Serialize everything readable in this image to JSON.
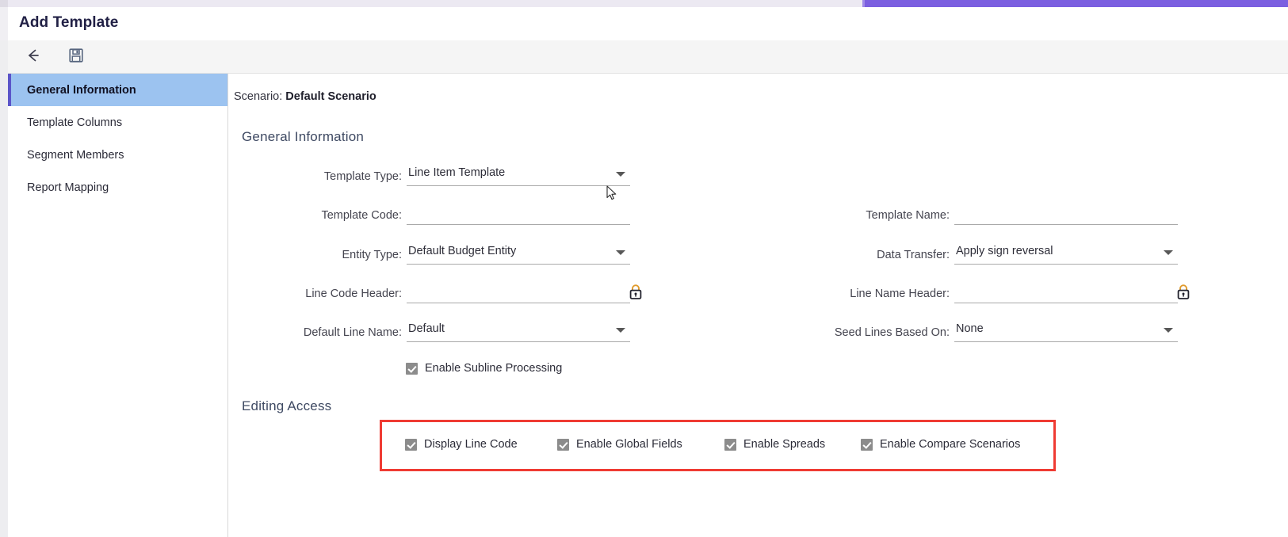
{
  "window": {
    "title": "Add Template",
    "accent_color": "#7b5fe0"
  },
  "toolbar": {
    "back_label": "Back",
    "back_icon": "arrow-left-icon",
    "save_label": "Save",
    "save_icon": "floppy-disk-save-icon"
  },
  "sidebar": {
    "items": [
      {
        "label": "General Information",
        "active": true
      },
      {
        "label": "Template Columns",
        "active": false
      },
      {
        "label": "Segment Members",
        "active": false
      },
      {
        "label": "Report Mapping",
        "active": false
      }
    ]
  },
  "content": {
    "scenario_label": "Scenario:",
    "scenario_value": "Default Scenario",
    "general_section_title": "General Information",
    "editing_section_title": "Editing Access",
    "left_fields": [
      {
        "label": "Template Type:",
        "value": "Line Item Template",
        "type": "dropdown",
        "placeholder": ""
      },
      {
        "label": "Template Code:",
        "value": "",
        "type": "text",
        "placeholder": ""
      },
      {
        "label": "Entity Type:",
        "value": "Default Budget Entity",
        "type": "dropdown",
        "placeholder": ""
      },
      {
        "label": "Line Code Header:",
        "value": "",
        "type": "text-locked",
        "placeholder": "",
        "lock_icon": "lock-icon"
      },
      {
        "label": "Default Line Name:",
        "value": "Default",
        "type": "dropdown",
        "placeholder": ""
      }
    ],
    "right_fields": [
      {
        "label": "Template Name:",
        "value": "",
        "type": "text",
        "placeholder": ""
      },
      {
        "label": "Data Transfer:",
        "value": "Apply sign reversal",
        "type": "dropdown",
        "placeholder": ""
      },
      {
        "label": "Line Name Header:",
        "value": "",
        "type": "text-locked",
        "placeholder": "",
        "lock_icon": "lock-icon"
      },
      {
        "label": "Seed Lines Based On:",
        "value": "None",
        "type": "dropdown",
        "placeholder": ""
      }
    ],
    "subline_checkbox": {
      "label": "Enable Subline Processing",
      "checked": true
    },
    "editing_access_checkboxes": [
      {
        "label": "Display Line Code",
        "checked": true
      },
      {
        "label": "Enable Global Fields",
        "checked": true
      },
      {
        "label": "Enable Spreads",
        "checked": true
      },
      {
        "label": "Enable Compare Scenarios",
        "checked": true
      }
    ],
    "highlight_color": "#ef3b33"
  }
}
